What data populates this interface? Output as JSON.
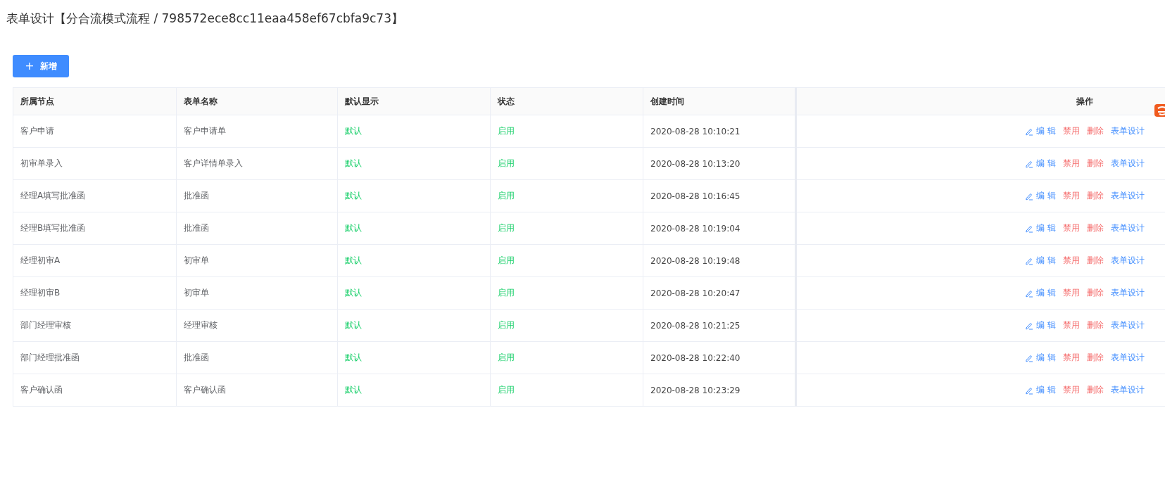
{
  "page": {
    "title": "表单设计【分合流模式流程 / 798572ece8cc11eaa458ef67cbfa9c73】"
  },
  "toolbar": {
    "add_button": {
      "icon": "+",
      "label": "新增"
    }
  },
  "table": {
    "columns": [
      "所属节点",
      "表单名称",
      "默认显示",
      "状态",
      "创建时间",
      "操作"
    ],
    "rows": [
      {
        "node": "客户申请",
        "form_name": "客户申请单",
        "default_display": "默认",
        "status": "启用",
        "created": "2020-08-28 10:10:21",
        "actions": [
          {
            "kind": "edit",
            "label": "编 辑"
          },
          {
            "kind": "danger",
            "label": "禁用"
          },
          {
            "kind": "danger",
            "label": "删除"
          },
          {
            "kind": "link",
            "label": "表单设计"
          }
        ]
      },
      {
        "node": "初审单录入",
        "form_name": "客户详情单录入",
        "default_display": "默认",
        "status": "启用",
        "created": "2020-08-28 10:13:20",
        "actions": [
          {
            "kind": "edit",
            "label": "编 辑"
          },
          {
            "kind": "danger",
            "label": "禁用"
          },
          {
            "kind": "danger",
            "label": "删除"
          },
          {
            "kind": "link",
            "label": "表单设计"
          }
        ]
      },
      {
        "node": "经理A填写批准函",
        "form_name": "批准函",
        "default_display": "默认",
        "status": "启用",
        "created": "2020-08-28 10:16:45",
        "actions": [
          {
            "kind": "edit",
            "label": "编 辑"
          },
          {
            "kind": "danger",
            "label": "禁用"
          },
          {
            "kind": "danger",
            "label": "删除"
          },
          {
            "kind": "link",
            "label": "表单设计"
          }
        ]
      },
      {
        "node": "经理B填写批准函",
        "form_name": "批准函",
        "default_display": "默认",
        "status": "启用",
        "created": "2020-08-28 10:19:04",
        "actions": [
          {
            "kind": "edit",
            "label": "编 辑"
          },
          {
            "kind": "danger",
            "label": "禁用"
          },
          {
            "kind": "danger",
            "label": "删除"
          },
          {
            "kind": "link",
            "label": "表单设计"
          }
        ]
      },
      {
        "node": "经理初审A",
        "form_name": "初审单",
        "default_display": "默认",
        "status": "启用",
        "created": "2020-08-28 10:19:48",
        "actions": [
          {
            "kind": "edit",
            "label": "编 辑"
          },
          {
            "kind": "danger",
            "label": "禁用"
          },
          {
            "kind": "danger",
            "label": "删除"
          },
          {
            "kind": "link",
            "label": "表单设计"
          }
        ]
      },
      {
        "node": "经理初审B",
        "form_name": "初审单",
        "default_display": "默认",
        "status": "启用",
        "created": "2020-08-28 10:20:47",
        "actions": [
          {
            "kind": "edit",
            "label": "编 辑"
          },
          {
            "kind": "danger",
            "label": "禁用"
          },
          {
            "kind": "danger",
            "label": "删除"
          },
          {
            "kind": "link",
            "label": "表单设计"
          }
        ]
      },
      {
        "node": "部门经理审核",
        "form_name": "经理审核",
        "default_display": "默认",
        "status": "启用",
        "created": "2020-08-28 10:21:25",
        "actions": [
          {
            "kind": "edit",
            "label": "编 辑"
          },
          {
            "kind": "danger",
            "label": "禁用"
          },
          {
            "kind": "danger",
            "label": "删除"
          },
          {
            "kind": "link",
            "label": "表单设计"
          }
        ]
      },
      {
        "node": "部门经理批准函",
        "form_name": "批准函",
        "default_display": "默认",
        "status": "启用",
        "created": "2020-08-28 10:22:40",
        "actions": [
          {
            "kind": "edit",
            "label": "编 辑"
          },
          {
            "kind": "danger",
            "label": "禁用"
          },
          {
            "kind": "danger",
            "label": "删除"
          },
          {
            "kind": "link",
            "label": "表单设计"
          }
        ]
      },
      {
        "node": "客户确认函",
        "form_name": "客户确认函",
        "default_display": "默认",
        "status": "启用",
        "created": "2020-08-28 10:23:29",
        "actions": [
          {
            "kind": "edit",
            "label": "编 辑"
          },
          {
            "kind": "danger",
            "label": "禁用"
          },
          {
            "kind": "danger",
            "label": "删除"
          },
          {
            "kind": "link",
            "label": "表单设计"
          }
        ]
      }
    ]
  }
}
